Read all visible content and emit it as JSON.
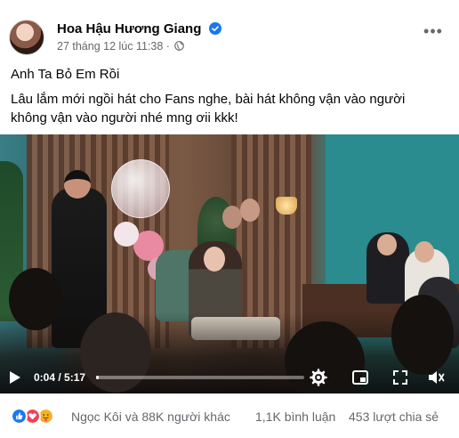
{
  "post": {
    "author": "Hoa Hậu Hương Giang",
    "timestamp": "27 tháng 12 lúc 11:38 ·",
    "title": "Anh Ta Bỏ Em Rồi",
    "body": "Lâu lắm mới ngồi hát cho Fans nghe, bài hát không vận vào người không vận vào người nhé mng ơii kkk!"
  },
  "video": {
    "time_display": "0:04 / 5:17",
    "progress_fraction": 0.0126
  },
  "footer": {
    "reactions_text": "Ngọc Kôi và 88K người khác",
    "comments_text": "1,1K bình luận",
    "shares_text": "453 lượt chia sẻ"
  },
  "icons": {
    "verified": "verified-badge-icon",
    "audience": "globe-icon",
    "more": "more-options-icon",
    "play": "play-icon",
    "settings": "gear-icon",
    "miniplayer": "miniplayer-icon",
    "fullscreen": "fullscreen-icon",
    "volume": "volume-icon",
    "reactions": [
      "like-reaction-icon",
      "love-reaction-icon",
      "care-reaction-icon"
    ]
  },
  "colors": {
    "link_blue": "#1877f2",
    "secondary_text": "#65676b",
    "love_red": "#f33e58",
    "care_yellow": "#f7b125"
  }
}
